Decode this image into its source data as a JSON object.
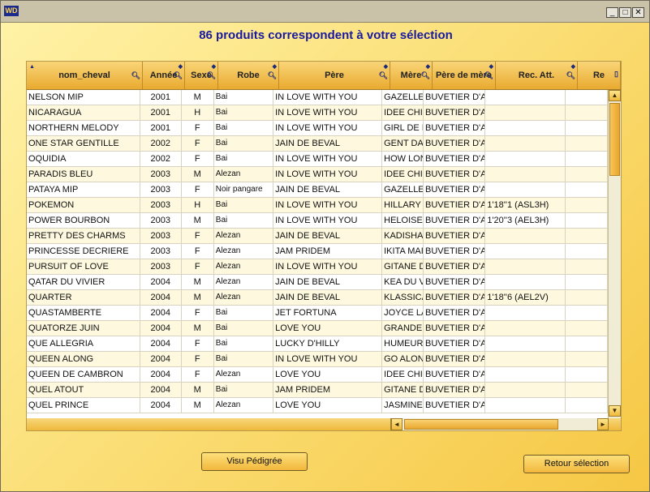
{
  "window": {
    "logo": "WD",
    "controls": [
      "_",
      "□",
      "✕"
    ]
  },
  "page_title": "86  produits correspondent à votre sélection",
  "columns": [
    {
      "label": "nom_cheval",
      "width": 143
    },
    {
      "label": "Année",
      "width": 52
    },
    {
      "label": "Sexe",
      "width": 41
    },
    {
      "label": "Robe",
      "width": 75
    },
    {
      "label": "Père",
      "width": 137
    },
    {
      "label": "Mère",
      "width": 52
    },
    {
      "label": "Père de mère",
      "width": 78
    },
    {
      "label": "Rec. Att.",
      "width": 101
    },
    {
      "label": "Re",
      "width": 53
    }
  ],
  "rows": [
    [
      "NELSON MIP",
      "2001",
      "M",
      "Bai",
      "IN LOVE WITH YOU",
      "GAZELLE",
      "BUVETIER D'A",
      "",
      ""
    ],
    [
      "NICARAGUA",
      "2001",
      "H",
      "Bai",
      "IN LOVE WITH YOU",
      "IDEE CHI",
      "BUVETIER D'A",
      "",
      ""
    ],
    [
      "NORTHERN MELODY",
      "2001",
      "F",
      "Bai",
      "IN LOVE WITH YOU",
      "GIRL DE I",
      "BUVETIER D'A",
      "",
      ""
    ],
    [
      "ONE STAR GENTILLE",
      "2002",
      "F",
      "Bai",
      "JAIN DE BEVAL",
      "GENT DA",
      "BUVETIER D'A",
      "",
      ""
    ],
    [
      "OQUIDIA",
      "2002",
      "F",
      "Bai",
      "IN LOVE WITH YOU",
      "HOW LON",
      "BUVETIER D'A",
      "",
      ""
    ],
    [
      "PARADIS BLEU",
      "2003",
      "M",
      "Alezan",
      "IN LOVE WITH YOU",
      "IDEE CHI",
      "BUVETIER D'A",
      "",
      ""
    ],
    [
      "PATAYA MIP",
      "2003",
      "F",
      "Noir pangare",
      "JAIN DE BEVAL",
      "GAZELLE",
      "BUVETIER D'A",
      "",
      ""
    ],
    [
      "POKEMON",
      "2003",
      "H",
      "Bai",
      "IN LOVE WITH YOU",
      "HILLARY",
      "BUVETIER D'A",
      "1'18''1 (ASL3H)",
      ""
    ],
    [
      "POWER BOURBON",
      "2003",
      "M",
      "Bai",
      "IN LOVE WITH YOU",
      "HELOISE",
      "BUVETIER D'A",
      "1'20''3 (AEL3H)",
      ""
    ],
    [
      "PRETTY DES CHARMS",
      "2003",
      "F",
      "Alezan",
      "JAIN DE BEVAL",
      "KADISHA",
      "BUVETIER D'A",
      "",
      ""
    ],
    [
      "PRINCESSE DECRIERE",
      "2003",
      "F",
      "Alezan",
      "JAM PRIDEM",
      "IKITA MAI",
      "BUVETIER D'A",
      "",
      ""
    ],
    [
      "PURSUIT OF LOVE",
      "2003",
      "F",
      "Alezan",
      "IN LOVE WITH YOU",
      "GITANE D",
      "BUVETIER D'A",
      "",
      ""
    ],
    [
      "QATAR DU VIVIER",
      "2004",
      "M",
      "Alezan",
      "JAIN DE BEVAL",
      "KEA DU V",
      "BUVETIER D'A",
      "",
      ""
    ],
    [
      "QUARTER",
      "2004",
      "M",
      "Alezan",
      "JAIN DE BEVAL",
      "KLASSICA",
      "BUVETIER D'A",
      "1'18''6 (AEL2V)",
      ""
    ],
    [
      "QUASTAMBERTE",
      "2004",
      "F",
      "Bai",
      "JET FORTUNA",
      "JOYCE LA",
      "BUVETIER D'A",
      "",
      ""
    ],
    [
      "QUATORZE JUIN",
      "2004",
      "M",
      "Bai",
      "LOVE YOU",
      "GRANDE",
      "BUVETIER D'A",
      "",
      ""
    ],
    [
      "QUE ALLEGRIA",
      "2004",
      "F",
      "Bai",
      "LUCKY D'HILLY",
      "HUMEUR",
      "BUVETIER D'A",
      "",
      ""
    ],
    [
      "QUEEN ALONG",
      "2004",
      "F",
      "Bai",
      "IN LOVE WITH YOU",
      "GO ALON",
      "BUVETIER D'A",
      "",
      ""
    ],
    [
      "QUEEN DE CAMBRON",
      "2004",
      "F",
      "Alezan",
      "LOVE YOU",
      "IDEE CHI",
      "BUVETIER D'A",
      "",
      ""
    ],
    [
      "QUEL ATOUT",
      "2004",
      "M",
      "Bai",
      "JAM PRIDEM",
      "GITANE D",
      "BUVETIER D'A",
      "",
      ""
    ],
    [
      "QUEL PRINCE",
      "2004",
      "M",
      "Alezan",
      "LOVE YOU",
      "JASMINE",
      "BUVETIER D'A",
      "",
      ""
    ]
  ],
  "buttons": {
    "pedigree": "Visu Pédigrée",
    "back": "Retour sélection"
  },
  "colors": {
    "title": "#1a1aa0",
    "header": "#eeb53f",
    "row_alt": "#fdf8de"
  }
}
